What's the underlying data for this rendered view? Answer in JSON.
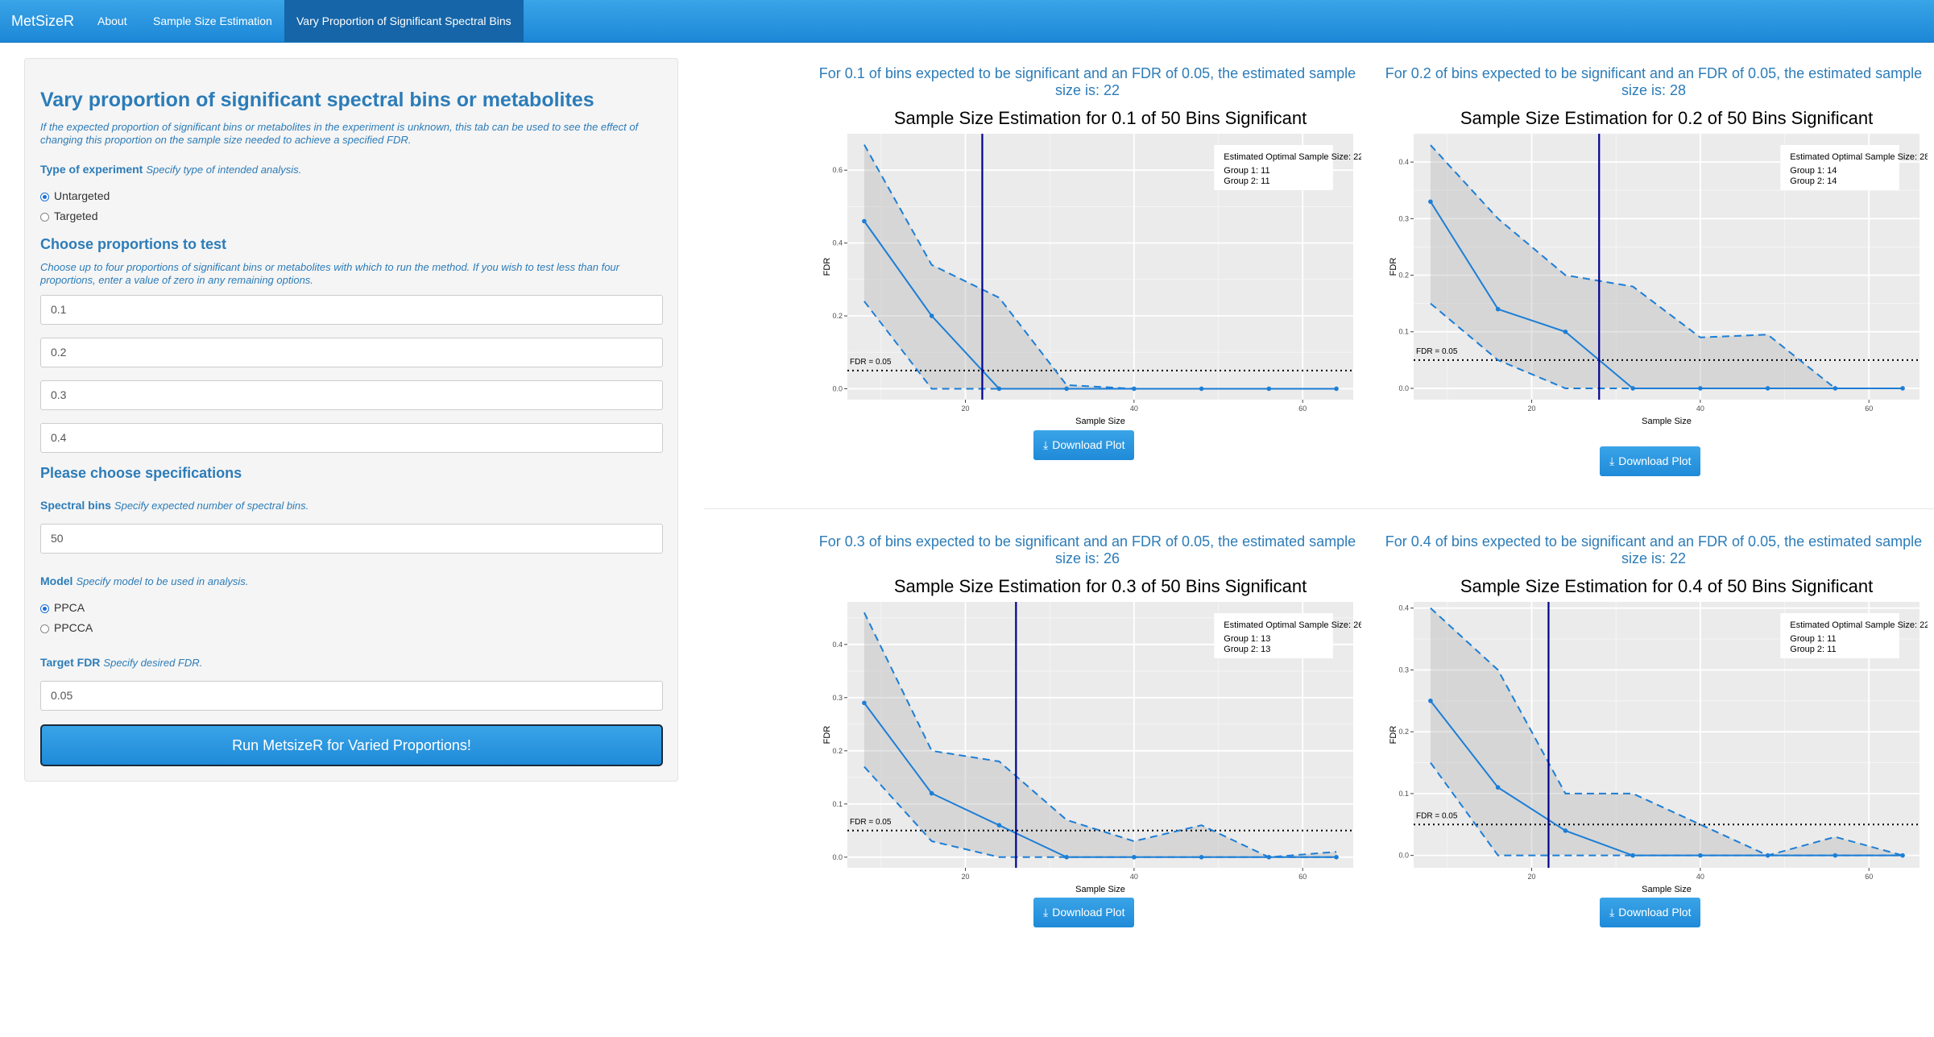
{
  "navbar": {
    "brand": "MetSizeR",
    "tabs": [
      {
        "label": "About",
        "active": false
      },
      {
        "label": "Sample Size Estimation",
        "active": false
      },
      {
        "label": "Vary Proportion of Significant Spectral Bins",
        "active": true
      }
    ]
  },
  "sidebar": {
    "title": "Vary proportion of significant spectral bins or metabolites",
    "description": "If the expected proportion of significant bins or metabolites in the experiment is unknown, this tab can be used to see the effect of changing this proportion on the sample size needed to achieve a specified FDR.",
    "experiment_label": "Type of experiment",
    "experiment_help": "Specify type of intended analysis.",
    "experiment_options": [
      {
        "label": "Untargeted",
        "selected": true
      },
      {
        "label": "Targeted",
        "selected": false
      }
    ],
    "proportions_heading": "Choose proportions to test",
    "proportions_help": "Choose up to four proportions of significant bins or metabolites with which to run the method. If you wish to test less than four proportions, enter a value of zero in any remaining options.",
    "proportions": [
      "0.1",
      "0.2",
      "0.3",
      "0.4"
    ],
    "spec_heading": "Please choose specifications",
    "bins_label": "Spectral bins",
    "bins_help": "Specify expected number of spectral bins.",
    "bins_value": "50",
    "model_label": "Model",
    "model_help": "Specify model to be used in analysis.",
    "model_options": [
      {
        "label": "PPCA",
        "selected": true
      },
      {
        "label": "PPCCA",
        "selected": false
      }
    ],
    "fdr_label": "Target FDR",
    "fdr_help": "Specify desired FDR.",
    "fdr_value": "0.05",
    "run_button": "Run MetsizeR for Varied Proportions!"
  },
  "download_label": "Download Plot",
  "download_icon": "download-icon",
  "colors": {
    "accent": "#2c7cb8",
    "line": "#1c7ed6",
    "vline": "#00008b",
    "panel_bg": "#ebebeb"
  },
  "results": [
    {
      "text": "For 0.1 of bins expected to be significant and an FDR of 0.05, the estimated sample size is: 22"
    },
    {
      "text": "For 0.2 of bins expected to be significant and an FDR of 0.05, the estimated sample size is: 28"
    },
    {
      "text": "For 0.3 of bins expected to be significant and an FDR of 0.05, the estimated sample size is: 26"
    },
    {
      "text": "For 0.4 of bins expected to be significant and an FDR of 0.05, the estimated sample size is: 22"
    }
  ],
  "chart_data": [
    {
      "type": "line",
      "title": "Sample Size Estimation for 0.1 of 50 Bins Significant",
      "xlabel": "Sample Size",
      "ylabel": "FDR",
      "xlim": [
        6,
        66
      ],
      "ylim": [
        -0.03,
        0.7
      ],
      "xticks": [
        20,
        40,
        60
      ],
      "yticks": [
        0.0,
        0.2,
        0.4,
        0.6
      ],
      "ytick_labels": [
        "0.0",
        "0.2",
        "0.4",
        "0.6"
      ],
      "x": [
        8,
        16,
        24,
        32,
        40,
        48,
        56,
        64
      ],
      "series": [
        {
          "name": "median",
          "style": "solid",
          "values": [
            0.46,
            0.2,
            0.0,
            0.0,
            0.0,
            0.0,
            0.0,
            0.0
          ]
        },
        {
          "name": "upper",
          "style": "dashed",
          "values": [
            0.67,
            0.34,
            0.25,
            0.01,
            0.0,
            0.0,
            0.0,
            0.0
          ]
        },
        {
          "name": "lower",
          "style": "dashed",
          "values": [
            0.24,
            0.0,
            0.0,
            0.0,
            0.0,
            0.0,
            0.0,
            0.0
          ]
        }
      ],
      "fdr_target": 0.05,
      "fdr_label": "FDR =  0.05",
      "optimal_sample_size": 22,
      "legend": {
        "line1": "Estimated Optimal Sample Size:  22",
        "line2": "Group 1:  11",
        "line3": "Group 2:  11"
      },
      "legend_position": "top-right",
      "grid": true
    },
    {
      "type": "line",
      "title": "Sample Size Estimation for 0.2 of 50 Bins Significant",
      "xlabel": "Sample Size",
      "ylabel": "FDR",
      "xlim": [
        6,
        66
      ],
      "ylim": [
        -0.02,
        0.45
      ],
      "xticks": [
        20,
        40,
        60
      ],
      "yticks": [
        0.0,
        0.1,
        0.2,
        0.3,
        0.4
      ],
      "ytick_labels": [
        "0.0",
        "0.1",
        "0.2",
        "0.3",
        "0.4"
      ],
      "x": [
        8,
        16,
        24,
        32,
        40,
        48,
        56,
        64
      ],
      "series": [
        {
          "name": "median",
          "style": "solid",
          "values": [
            0.33,
            0.14,
            0.1,
            0.0,
            0.0,
            0.0,
            0.0,
            0.0
          ]
        },
        {
          "name": "upper",
          "style": "dashed",
          "values": [
            0.43,
            0.3,
            0.2,
            0.18,
            0.09,
            0.095,
            0.0,
            0.0
          ]
        },
        {
          "name": "lower",
          "style": "dashed",
          "values": [
            0.15,
            0.05,
            0.0,
            0.0,
            0.0,
            0.0,
            0.0,
            0.0
          ]
        }
      ],
      "fdr_target": 0.05,
      "fdr_label": "FDR =  0.05",
      "optimal_sample_size": 28,
      "legend": {
        "line1": "Estimated Optimal Sample Size:  28",
        "line2": "Group 1:  14",
        "line3": "Group 2:  14"
      },
      "legend_position": "top-right",
      "grid": true
    },
    {
      "type": "line",
      "title": "Sample Size Estimation for 0.3 of 50 Bins Significant",
      "xlabel": "Sample Size",
      "ylabel": "FDR",
      "xlim": [
        6,
        66
      ],
      "ylim": [
        -0.02,
        0.48
      ],
      "xticks": [
        20,
        40,
        60
      ],
      "yticks": [
        0.0,
        0.1,
        0.2,
        0.3,
        0.4
      ],
      "ytick_labels": [
        "0.0",
        "0.1",
        "0.2",
        "0.3",
        "0.4"
      ],
      "x": [
        8,
        16,
        24,
        32,
        40,
        48,
        56,
        64
      ],
      "series": [
        {
          "name": "median",
          "style": "solid",
          "values": [
            0.29,
            0.12,
            0.06,
            0.0,
            0.0,
            0.0,
            0.0,
            0.0
          ]
        },
        {
          "name": "upper",
          "style": "dashed",
          "values": [
            0.46,
            0.2,
            0.18,
            0.07,
            0.03,
            0.06,
            0.0,
            0.01
          ]
        },
        {
          "name": "lower",
          "style": "dashed",
          "values": [
            0.17,
            0.03,
            0.0,
            0.0,
            0.0,
            0.0,
            0.0,
            0.0
          ]
        }
      ],
      "fdr_target": 0.05,
      "fdr_label": "FDR =  0.05",
      "optimal_sample_size": 26,
      "legend": {
        "line1": "Estimated Optimal Sample Size:  26",
        "line2": "Group 1:  13",
        "line3": "Group 2:  13"
      },
      "legend_position": "top-right",
      "grid": true
    },
    {
      "type": "line",
      "title": "Sample Size Estimation for 0.4 of 50 Bins Significant",
      "xlabel": "Sample Size",
      "ylabel": "FDR",
      "xlim": [
        6,
        66
      ],
      "ylim": [
        -0.02,
        0.41
      ],
      "xticks": [
        20,
        40,
        60
      ],
      "yticks": [
        0.0,
        0.1,
        0.2,
        0.3,
        0.4
      ],
      "ytick_labels": [
        "0.0",
        "0.1",
        "0.2",
        "0.3",
        "0.4"
      ],
      "x": [
        8,
        16,
        24,
        32,
        40,
        48,
        56,
        64
      ],
      "series": [
        {
          "name": "median",
          "style": "solid",
          "values": [
            0.25,
            0.11,
            0.04,
            0.0,
            0.0,
            0.0,
            0.0,
            0.0
          ]
        },
        {
          "name": "upper",
          "style": "dashed",
          "values": [
            0.4,
            0.3,
            0.1,
            0.1,
            0.05,
            0.0,
            0.03,
            0.0
          ]
        },
        {
          "name": "lower",
          "style": "dashed",
          "values": [
            0.15,
            0.0,
            0.0,
            0.0,
            0.0,
            0.0,
            0.0,
            0.0
          ]
        }
      ],
      "fdr_target": 0.05,
      "fdr_label": "FDR =  0.05",
      "optimal_sample_size": 22,
      "legend": {
        "line1": "Estimated Optimal Sample Size:  22",
        "line2": "Group 1:  11",
        "line3": "Group 2:  11"
      },
      "legend_position": "top-right",
      "grid": true
    }
  ]
}
